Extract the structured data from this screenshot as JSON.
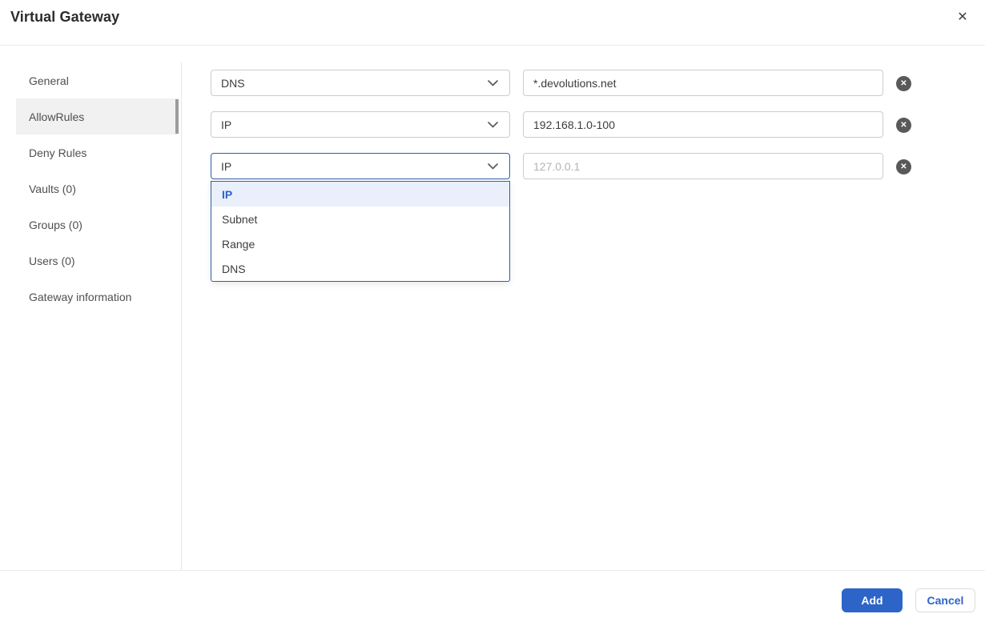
{
  "dialog": {
    "title": "Virtual Gateway"
  },
  "icons": {
    "close": "✕",
    "delete": "✕"
  },
  "sidebar": {
    "items": [
      {
        "label": "General",
        "selected": false
      },
      {
        "label": "AllowRules",
        "selected": true
      },
      {
        "label": "Deny Rules",
        "selected": false
      },
      {
        "label": "Vaults (0)",
        "selected": false
      },
      {
        "label": "Groups (0)",
        "selected": false
      },
      {
        "label": "Users (0)",
        "selected": false
      },
      {
        "label": "Gateway information",
        "selected": false
      }
    ]
  },
  "rules": [
    {
      "type": "DNS",
      "value": "*.devolutions.net",
      "placeholder": ""
    },
    {
      "type": "IP",
      "value": "192.168.1.0-100",
      "placeholder": ""
    },
    {
      "type": "IP",
      "value": "",
      "placeholder": "127.0.0.1",
      "open": true
    }
  ],
  "dropdown": {
    "options": [
      "IP",
      "Subnet",
      "Range",
      "DNS"
    ],
    "highlighted": "IP"
  },
  "footer": {
    "add_label": "Add",
    "cancel_label": "Cancel"
  },
  "colors": {
    "accent_blue": "#2d64c8",
    "focus_border": "#2f5fa8",
    "option_highlight_bg": "#e9f0fb",
    "delete_button_bg": "#595959",
    "selected_item_bg": "#f1f1f1"
  }
}
